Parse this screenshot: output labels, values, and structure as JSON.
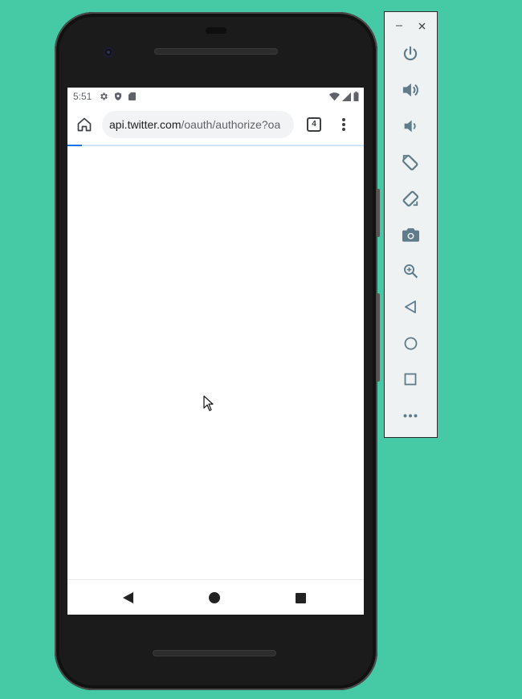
{
  "status_bar": {
    "time": "5:51",
    "left_icons": [
      "gear-icon",
      "shield-icon",
      "sd-card-icon"
    ],
    "right_icons": [
      "wifi-icon",
      "signal-icon",
      "battery-icon"
    ]
  },
  "browser": {
    "url_host": "api.twitter.com",
    "url_path": "/oauth/authorize?oa",
    "tab_count": "4",
    "load_progress_percent": 5
  },
  "nav_bar": {
    "icons": [
      "back-triangle-icon",
      "home-circle-icon",
      "overview-square-icon"
    ]
  },
  "emulator_panel": {
    "window_icons": [
      "minimize-icon",
      "close-icon"
    ],
    "buttons": [
      {
        "id": "power",
        "icon": "power-icon"
      },
      {
        "id": "volume-up",
        "icon": "volume-up-icon"
      },
      {
        "id": "volume-down",
        "icon": "volume-down-icon"
      },
      {
        "id": "rotate-left",
        "icon": "rotate-left-icon"
      },
      {
        "id": "rotate-right",
        "icon": "rotate-right-icon"
      },
      {
        "id": "screenshot",
        "icon": "camera-icon"
      },
      {
        "id": "zoom",
        "icon": "zoom-icon"
      },
      {
        "id": "back",
        "icon": "back-icon"
      },
      {
        "id": "home",
        "icon": "home-icon"
      },
      {
        "id": "overview",
        "icon": "overview-icon"
      },
      {
        "id": "more",
        "icon": "more-icon"
      }
    ]
  },
  "colors": {
    "desktop_background": "#46c9a5",
    "panel_icon": "#5f7c8a",
    "progress": "#1a73e8"
  }
}
